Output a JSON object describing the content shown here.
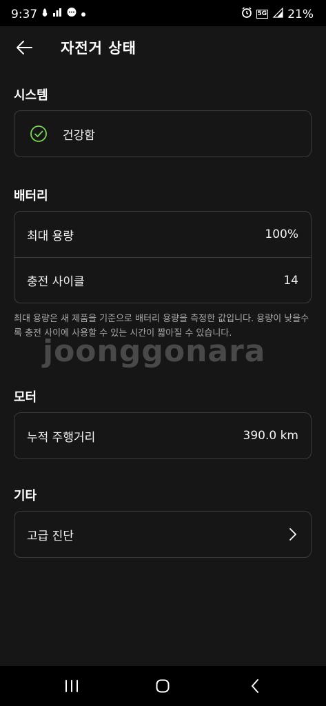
{
  "status_bar": {
    "time": "9:37",
    "network": "5G",
    "battery": "21%"
  },
  "header": {
    "title": "자전거 상태",
    "back_icon": "arrow-left-icon"
  },
  "system": {
    "title": "시스템",
    "status_label": "건강함",
    "status_icon": "check-circle-icon",
    "accent": "#7ed957"
  },
  "battery": {
    "title": "배터리",
    "rows": [
      {
        "label": "최대 용량",
        "value": "100%"
      },
      {
        "label": "충전 사이클",
        "value": "14"
      }
    ],
    "info": "최대 용량은 새 제품을 기준으로 배터리 용량을 측정한 값입니다. 용량이 낮을수록 충전 사이에 사용할 수 있는 시간이 짧아질 수 있습니다."
  },
  "motor": {
    "title": "모터",
    "rows": [
      {
        "label": "누적 주행거리",
        "value": "390.0 km"
      }
    ]
  },
  "etc": {
    "title": "기타",
    "rows": [
      {
        "label": "고급 진단",
        "icon": "chevron-right-icon"
      }
    ]
  },
  "watermark": "joonggonara"
}
